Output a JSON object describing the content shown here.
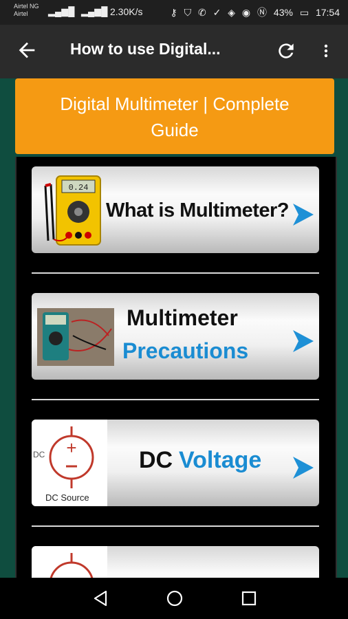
{
  "status": {
    "carrier1": "Airtel NG",
    "carrier2": "Airtel",
    "speed": "2.30K/s",
    "battery": "43%",
    "time": "17:54"
  },
  "appbar": {
    "title": "How to use Digital..."
  },
  "header": {
    "line1": "Digital Multimeter | Complete",
    "line2": "Guide"
  },
  "items": [
    {
      "label": "What is Multimeter?",
      "color": "#111111"
    },
    {
      "label_line1": "Multimeter",
      "label_line2": "Precautions",
      "color2": "#1a8cd2"
    },
    {
      "label_part1": "DC",
      "label_part2": "Voltage",
      "thumb_caption": "DC Source",
      "thumb_side": "DC",
      "color2": "#1a8cd2"
    }
  ],
  "colors": {
    "accent": "#f59a13",
    "background": "#0f4d3f",
    "arrow": "#1e90d6"
  },
  "icons": [
    "back-arrow-icon",
    "refresh-icon",
    "more-vert-icon",
    "nav-back-icon",
    "nav-home-icon",
    "nav-recents-icon"
  ]
}
